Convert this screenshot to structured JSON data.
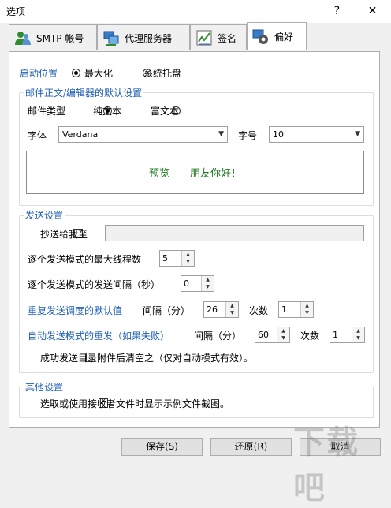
{
  "window": {
    "title": "选项",
    "help": "?",
    "close": "✕"
  },
  "tabs": [
    {
      "label": "SMTP 帐号",
      "icon": "users-icon"
    },
    {
      "label": "代理服务器",
      "icon": "network-icon"
    },
    {
      "label": "签名",
      "icon": "signature-icon"
    },
    {
      "label": "偏好",
      "icon": "gear-icon",
      "active": true
    }
  ],
  "startup": {
    "label": "启动位置",
    "options": [
      "最大化",
      "系统托盘"
    ],
    "selected": "最大化"
  },
  "editor_group": {
    "title": "邮件正文/编辑器的默认设置",
    "mail_type_label": "邮件类型",
    "mail_types": [
      "纯文本",
      "富文本"
    ],
    "mail_type_selected": "纯文本",
    "font_label": "字体",
    "font_value": "Verdana",
    "size_label": "字号",
    "size_value": "10",
    "preview_text": "预览——朋友你好！"
  },
  "send_group": {
    "title": "发送设置",
    "cc_label": "抄送给我至",
    "cc_value": "",
    "max_threads_label": "逐个发送模式的最大线程数",
    "max_threads": "5",
    "interval_label": "逐个发送模式的发送间隔（秒）",
    "interval": "0",
    "retry_label": "重复发送调度的默认值",
    "retry_interval_label": "间隔（分）",
    "retry_interval": "26",
    "retry_count_label": "次数",
    "retry_count": "1",
    "auto_label": "自动发送模式的重发（如果失败）",
    "auto_interval_label": "间隔（分）",
    "auto_interval": "60",
    "auto_count_label": "次数",
    "auto_count": "1",
    "clear_label": "成功发送目录附件后清空之（仅对自动模式有效）。"
  },
  "other_group": {
    "title": "其他设置",
    "preview_label": "选取或使用接收者文件时显示示例文件截图。"
  },
  "buttons": {
    "save": "保存(S)",
    "restore": "还原(R)",
    "cancel": "取消"
  },
  "watermark": "下载吧"
}
